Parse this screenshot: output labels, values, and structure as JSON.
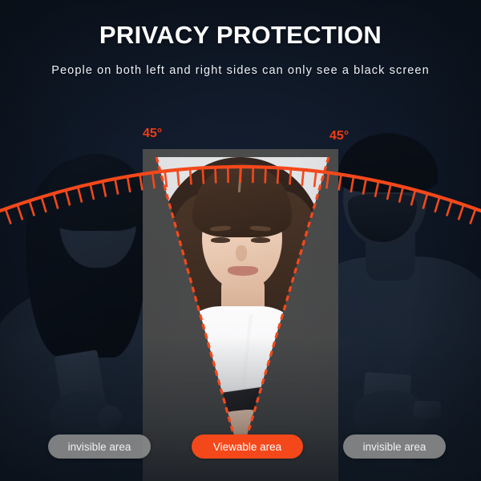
{
  "header": {
    "title": "PRIVACY PROTECTION",
    "subtitle": "People on both left and right sides can only see a black screen"
  },
  "protractor": {
    "angle_left_label": "45°",
    "angle_right_label": "45°",
    "arc_color": "#f4481b",
    "tick_count": 40,
    "cone_fill": "#e2e3e5",
    "cone_edge_style": "dashed"
  },
  "legend": {
    "left": {
      "label": "invisible area",
      "color": "#969696"
    },
    "center": {
      "label": "Viewable area",
      "color": "#f4481b"
    },
    "right": {
      "label": "invisible area",
      "color": "#969696"
    }
  },
  "scene": {
    "background_color": "#22334a",
    "left_person": "woman-holding-phone-dimmed",
    "center_person": "woman-holding-phone-visible",
    "right_person": "man-holding-phone-dimmed"
  }
}
